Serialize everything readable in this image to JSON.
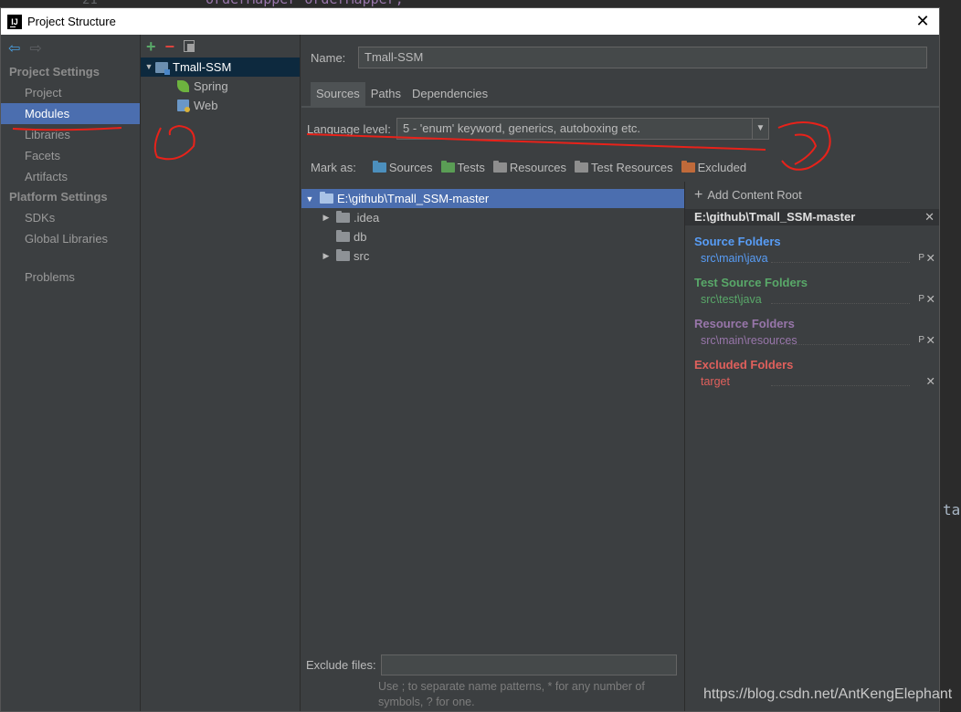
{
  "background": {
    "code_line": "orderMapper orderMapper;",
    "gutter": "21",
    "right_fragment": "ta"
  },
  "window": {
    "title": "Project Structure",
    "app_icon_text": "IJ",
    "close_glyph": "✕"
  },
  "leftnav": {
    "back_glyph": "⇦",
    "forward_glyph": "⇨",
    "sections": [
      {
        "header": "Project Settings",
        "items": [
          "Project",
          "Modules",
          "Libraries",
          "Facets",
          "Artifacts"
        ]
      },
      {
        "header": "Platform Settings",
        "items": [
          "SDKs",
          "Global Libraries"
        ]
      }
    ],
    "problems": "Problems",
    "selected": "Modules"
  },
  "modtree": {
    "plus": "+",
    "minus": "−",
    "root": "Tmall-SSM",
    "children": [
      "Spring",
      "Web"
    ]
  },
  "module": {
    "name_label": "Name:",
    "name_value": "Tmall-SSM",
    "tabs": [
      "Sources",
      "Paths",
      "Dependencies"
    ],
    "active_tab": "Sources",
    "language_label": "Language level:",
    "language_value": "5 - 'enum' keyword, generics, autoboxing etc.",
    "mark_as": "Mark as:",
    "mark_items": [
      "Sources",
      "Tests",
      "Resources",
      "Test Resources",
      "Excluded"
    ],
    "folder_root": "E:\\github\\Tmall_SSM-master",
    "folders": [
      {
        "name": ".idea",
        "expandable": true
      },
      {
        "name": "db",
        "expandable": false
      },
      {
        "name": "src",
        "expandable": true
      }
    ],
    "add_content_root": "Add Content Root",
    "content_root": "E:\\github\\Tmall_SSM-master",
    "groups": [
      {
        "title": "Source Folders",
        "path": "src\\main\\java",
        "color": "#589df6",
        "props": true
      },
      {
        "title": "Test Source Folders",
        "path": "src\\test\\java",
        "color": "#59a869",
        "props": true
      },
      {
        "title": "Resource Folders",
        "path": "src\\main\\resources",
        "color": "#9876aa",
        "props": true
      },
      {
        "title": "Excluded Folders",
        "path": "target",
        "color": "#e0605c",
        "props": false
      }
    ],
    "exclude_label": "Exclude files:",
    "exclude_value": "",
    "exclude_hint_1": "Use ; to separate name patterns, * for any number of",
    "exclude_hint_2": "symbols, ? for one."
  },
  "watermark": "https://blog.csdn.net/AntKengElephant"
}
